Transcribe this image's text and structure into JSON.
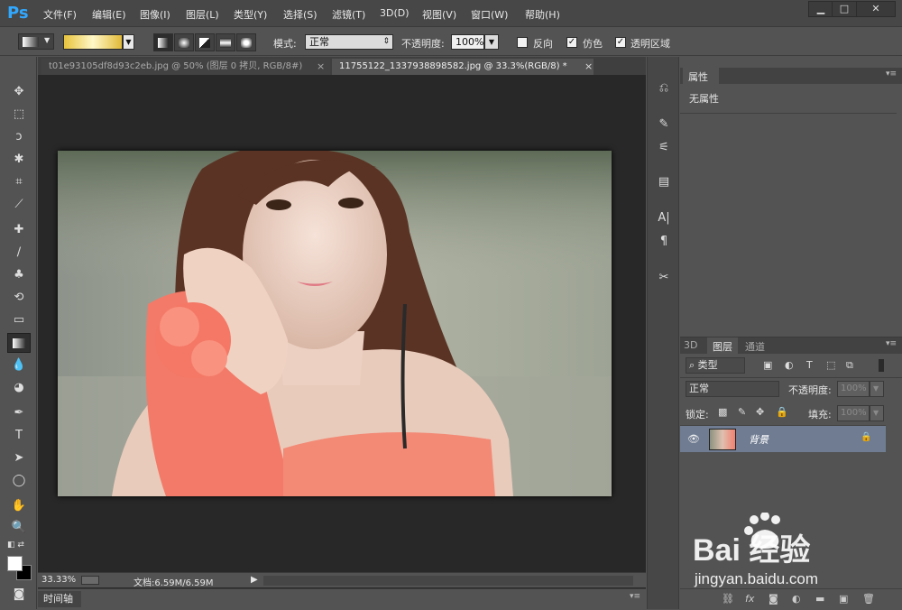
{
  "app": {
    "logo": "Ps"
  },
  "menubar": {
    "items": [
      "文件(F)",
      "编辑(E)",
      "图像(I)",
      "图层(L)",
      "类型(Y)",
      "选择(S)",
      "滤镜(T)",
      "3D(D)",
      "视图(V)",
      "窗口(W)",
      "帮助(H)"
    ]
  },
  "window_controls": {
    "minimize": "▁",
    "maximize": "□",
    "close": "✕"
  },
  "options": {
    "mode_label": "模式:",
    "mode_value": "正常",
    "opacity_label": "不透明度:",
    "opacity_value": "100%",
    "reverse_label": "反向",
    "dither_label": "仿色",
    "transparency_label": "透明区域",
    "gradient_colors": [
      "#e7c33c",
      "#fff8c8",
      "#e1b938"
    ]
  },
  "tabs": [
    {
      "label": "t01e93105df8d93c2eb.jpg @ 50% (图层 0 拷贝, RGB/8#)",
      "close": "×"
    },
    {
      "label": "11755122_1337938898582.jpg @ 33.3%(RGB/8) *",
      "close": "×"
    }
  ],
  "status": {
    "zoom": "33.33%",
    "doc": "文档:6.59M/6.59M",
    "arrow": "▶"
  },
  "timeline": {
    "label": "时间轴"
  },
  "properties": {
    "tab": "属性",
    "content": "无属性"
  },
  "layers_panel": {
    "tabs": [
      "3D",
      "图层",
      "通道"
    ],
    "kind": "类型",
    "blend": "正常",
    "opacity_label": "不透明度:",
    "opacity_value": "100%",
    "lock_label": "锁定:",
    "fill_label": "填充:",
    "fill_value": "100%",
    "layer_name": "背景"
  },
  "watermark": {
    "brand": "Bai 经验",
    "url": "jingyan.baidu.com"
  }
}
